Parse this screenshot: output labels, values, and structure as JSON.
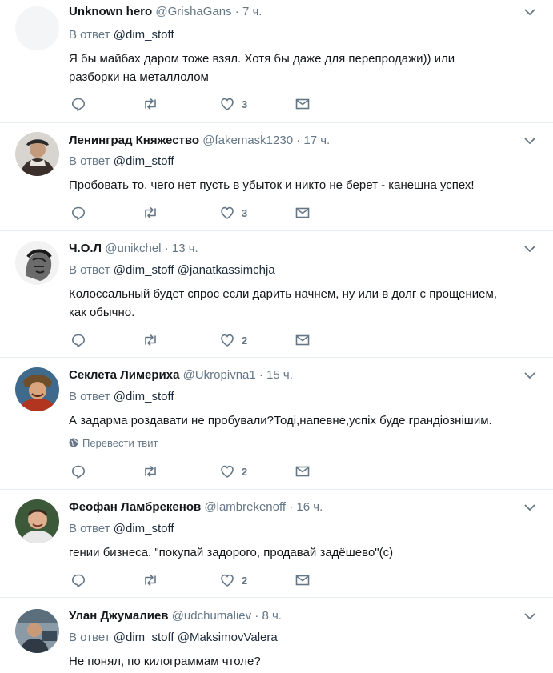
{
  "tweets": [
    {
      "name": "Unknown hero",
      "handle": "@GrishaGans",
      "time": "7 ч.",
      "reply_prefix": "В ответ",
      "reply_to": "@dim_stoff",
      "text": [
        "Я бы майбах даром тоже взял. Хотя бы даже для перепродажи)) или",
        "разборки на металлолом"
      ],
      "likes": "3"
    },
    {
      "name": "Ленинград Княжество",
      "handle": "@fakemask1230",
      "time": "17 ч.",
      "reply_prefix": "В ответ",
      "reply_to": "@dim_stoff",
      "text": [
        "Пробовать то, чего нет пусть в убыток и никто не берет - канешна успех!"
      ],
      "likes": "3"
    },
    {
      "name": "Ч.О.Л",
      "handle": "@unikchel",
      "time": "13 ч.",
      "reply_prefix": "В ответ",
      "reply_to": "@dim_stoff @janatkassimchja",
      "text": [
        "Колоссальный будет спрос если дарить начнем, ну или в долг с прощением,",
        "как обычно."
      ],
      "likes": "2"
    },
    {
      "name": "Секлета Лимериха",
      "handle": "@Ukropivna1",
      "time": "15 ч.",
      "reply_prefix": "В ответ",
      "reply_to": "@dim_stoff",
      "text": [
        "А задарма роздавати не пробували?Тоді,напевне,успіх буде грандіознішим."
      ],
      "translate": "Перевести твит",
      "likes": "2"
    },
    {
      "name": "Феофан Ламбрекенов",
      "handle": "@lambrekenoff",
      "time": "16 ч.",
      "reply_prefix": "В ответ",
      "reply_to": "@dim_stoff",
      "text": [
        "гении бизнеса. \"покупай задорого, продавай задёшево\"(с)"
      ],
      "likes": "2"
    },
    {
      "name": "Улан Джумалиев",
      "handle": "@udchumaliev",
      "time": "8 ч.",
      "reply_prefix": "В ответ",
      "reply_to": "@dim_stoff @MaksimovValera",
      "text": [
        "Не понял, по килограммам чтоле?"
      ],
      "likes": ""
    }
  ],
  "separator": "·",
  "colors": {
    "secondary": "#657786",
    "text": "#14171a",
    "border": "#e6ecf0"
  }
}
